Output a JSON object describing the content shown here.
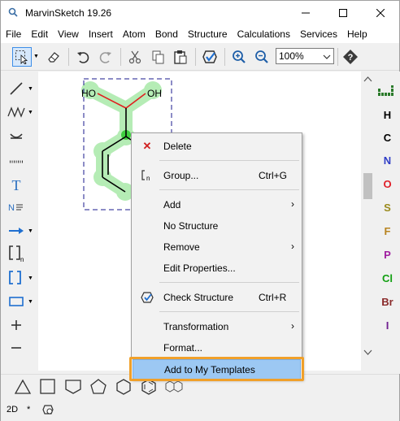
{
  "window": {
    "title": "MarvinSketch 19.26",
    "controls": [
      "minimize",
      "maximize",
      "close"
    ]
  },
  "menubar": [
    "File",
    "Edit",
    "View",
    "Insert",
    "Atom",
    "Bond",
    "Structure",
    "Calculations",
    "Services",
    "Help"
  ],
  "toolbar": {
    "zoom_value": "100%",
    "icons": [
      "selection-icon",
      "erase-icon",
      "undo-icon",
      "redo-icon",
      "cut-icon",
      "copy-icon",
      "paste-icon",
      "check-structure-icon",
      "zoom-in-icon",
      "zoom-out-icon",
      "help-icon"
    ]
  },
  "molecule": {
    "labels": [
      "HO",
      "OH"
    ]
  },
  "periodic_shortcuts": [
    {
      "symbol": "H",
      "color": "#000000"
    },
    {
      "symbol": "C",
      "color": "#000000"
    },
    {
      "symbol": "N",
      "color": "#2f3dc6"
    },
    {
      "symbol": "O",
      "color": "#e0202a"
    },
    {
      "symbol": "S",
      "color": "#9a8a1c"
    },
    {
      "symbol": "F",
      "color": "#b88420"
    },
    {
      "symbol": "P",
      "color": "#a020a0"
    },
    {
      "symbol": "Cl",
      "color": "#12a012"
    },
    {
      "symbol": "Br",
      "color": "#8a2a2a"
    },
    {
      "symbol": "I",
      "color": "#702090"
    }
  ],
  "context_menu": {
    "items": [
      {
        "label": "Delete",
        "shortcut": "",
        "submenu": false,
        "icon": "delete-x-icon"
      },
      {
        "label": "Group...",
        "shortcut": "Ctrl+G",
        "submenu": false,
        "icon": "group-bracket-icon"
      },
      {
        "label": "Add",
        "shortcut": "",
        "submenu": true,
        "icon": ""
      },
      {
        "label": "No Structure",
        "shortcut": "",
        "submenu": false,
        "icon": ""
      },
      {
        "label": "Remove",
        "shortcut": "",
        "submenu": true,
        "icon": ""
      },
      {
        "label": "Edit Properties...",
        "shortcut": "",
        "submenu": false,
        "icon": ""
      },
      {
        "label": "Check Structure",
        "shortcut": "Ctrl+R",
        "submenu": false,
        "icon": "check-structure-icon"
      },
      {
        "label": "Transformation",
        "shortcut": "",
        "submenu": true,
        "icon": ""
      },
      {
        "label": "Format...",
        "shortcut": "",
        "submenu": false,
        "icon": ""
      },
      {
        "label": "Add to My Templates",
        "shortcut": "",
        "submenu": false,
        "icon": "",
        "highlighted": true
      }
    ]
  },
  "statusbar": {
    "mode": "2D",
    "modified": "*"
  },
  "colors": {
    "accent_highlight": "#9cc8f3",
    "callout_ring": "#f0a02a",
    "selection_green": "#7ee07e"
  }
}
